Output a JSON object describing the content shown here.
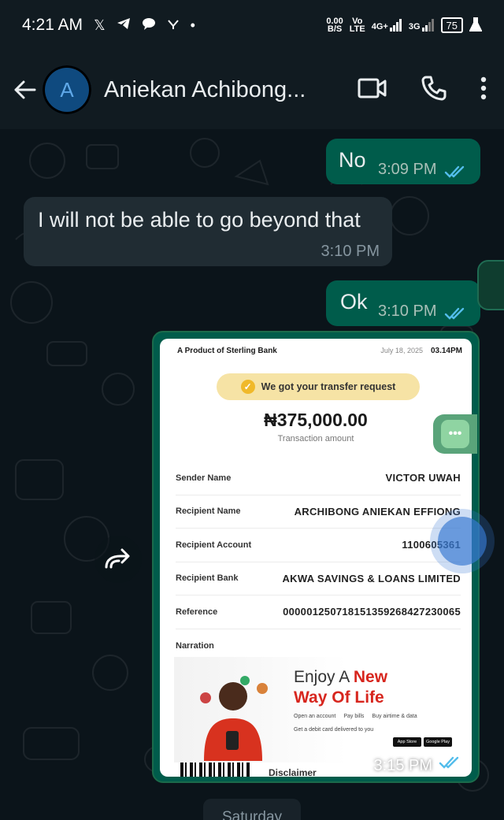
{
  "status_bar": {
    "time": "4:21 AM",
    "net_speed_value": "0.00",
    "net_speed_unit": "B/S",
    "volte_top": "Vo",
    "volte_bottom": "LTE",
    "network_4g": "4G+",
    "network_3g": "3G",
    "battery": "75"
  },
  "header": {
    "avatar_letter": "A",
    "contact_name": "Aniekan Achibong..."
  },
  "messages": [
    {
      "text": "No",
      "time": "3:09 PM",
      "direction": "outgoing",
      "read": true
    },
    {
      "text": "I will not be able to go beyond that",
      "time": "3:10 PM",
      "direction": "incoming"
    },
    {
      "text": "Ok",
      "time": "3:10 PM",
      "direction": "outgoing",
      "read": true
    }
  ],
  "image_message": {
    "time": "3:15 PM",
    "receipt": {
      "brand": "A Product of Sterling Bank",
      "date": "July 18, 2025",
      "clock": "03.14PM",
      "status": "We got your transfer request",
      "amount": "₦375,000.00",
      "amount_label": "Transaction amount",
      "rows": [
        {
          "label": "Sender Name",
          "value": "VICTOR UWAH"
        },
        {
          "label": "Recipient Name",
          "value": "ARCHIBONG ANIEKAN EFFIONG"
        },
        {
          "label": "Recipient Account",
          "value": "1100605361"
        },
        {
          "label": "Recipient Bank",
          "value": "AKWA SAVINGS & LOANS LIMITED"
        },
        {
          "label": "Reference",
          "value": "000001250718151359268427230065"
        },
        {
          "label": "Narration",
          "value": ""
        }
      ],
      "ad": {
        "line1_plain": "Enjoy A ",
        "line1_bold": "New",
        "line2": "Way Of Life",
        "bullets": [
          "Open an account",
          "Pay bills",
          "Buy airtime & data",
          "Get a debit card delivered to you"
        ],
        "store1": "App Store",
        "store2": "Google Play"
      },
      "disclaimer": "Disclaimer"
    }
  },
  "day_separator": "Saturday",
  "colors": {
    "background": "#0b141a",
    "outgoing_bubble": "#005c4b",
    "incoming_bubble": "#202c33",
    "read_tick": "#53bdeb"
  }
}
